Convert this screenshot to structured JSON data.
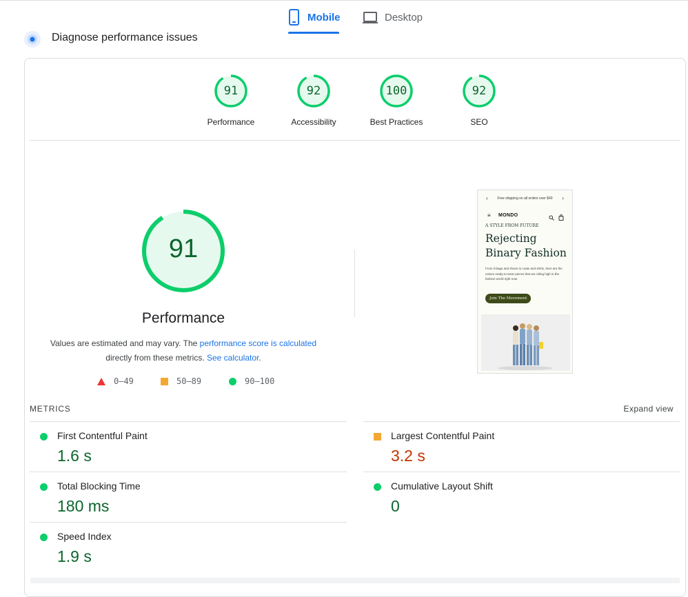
{
  "tabs": [
    {
      "label": "Mobile",
      "icon": "smartphone-icon",
      "active": true
    },
    {
      "label": "Desktop",
      "icon": "laptop-icon",
      "active": false
    }
  ],
  "diagnose": {
    "title": "Diagnose performance issues",
    "icon": "diagnose-icon"
  },
  "categories": [
    {
      "score": "91",
      "label": "Performance",
      "score_value": 91
    },
    {
      "score": "92",
      "label": "Accessibility",
      "score_value": 92
    },
    {
      "score": "100",
      "label": "Best Practices",
      "score_value": 100
    },
    {
      "score": "92",
      "label": "SEO",
      "score_value": 92
    }
  ],
  "performance": {
    "score": "91",
    "score_value": 91,
    "title": "Performance",
    "desc_part1": "Values are estimated and may vary. The ",
    "desc_link1": "performance score is calculated",
    "desc_part2": "directly from these metrics. ",
    "desc_link2": "See calculator",
    "desc_part3": "."
  },
  "legend": [
    {
      "range": "0–49",
      "shape": "triangle",
      "color": "#eb3636"
    },
    {
      "range": "50–89",
      "shape": "square",
      "color": "#f4a833"
    },
    {
      "range": "90–100",
      "shape": "circle",
      "color": "#0cce6b"
    }
  ],
  "screenshot": {
    "banner": "Free shipping on all orders over $40",
    "brand": "MONDO",
    "kicker": "A STYLE FROM FUTURE",
    "headline": "Rejecting Binary Fashion",
    "body": "From it-bags and shoes to coats and shirts, here are the unisex ready-to-wear pieces that are riding high in the fashion world right now.",
    "cta": "Join The Movement"
  },
  "metrics": {
    "header": "METRICS",
    "expand": "Expand view",
    "items": [
      {
        "name": "First Contentful Paint",
        "value": "1.6 s",
        "rating": "good"
      },
      {
        "name": "Largest Contentful Paint",
        "value": "3.2 s",
        "rating": "average"
      },
      {
        "name": "Total Blocking Time",
        "value": "180 ms",
        "rating": "good"
      },
      {
        "name": "Cumulative Layout Shift",
        "value": "0",
        "rating": "good"
      },
      {
        "name": "Speed Index",
        "value": "1.9 s",
        "rating": "good"
      }
    ]
  },
  "colors": {
    "accent": "#1a73e8",
    "pass": "#0cce6b",
    "pass_text": "#0d652d",
    "average": "#f4a833",
    "average_text": "#c33300",
    "fail": "#eb3636"
  }
}
